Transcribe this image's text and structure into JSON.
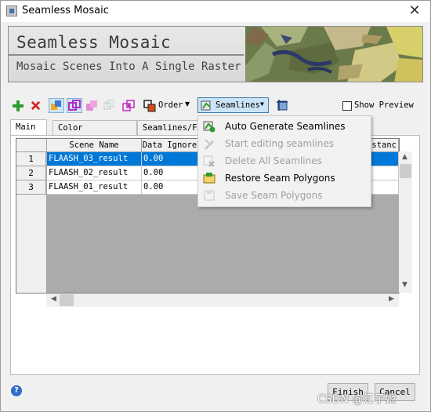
{
  "window": {
    "title": "Seamless Mosaic",
    "close_glyph": "✕"
  },
  "banner": {
    "title": "Seamless Mosaic",
    "subtitle": "Mosaic Scenes Into A Single Raster"
  },
  "toolbar": {
    "order_label": "Order",
    "seamlines_label": "Seamlines",
    "show_preview_label": "Show Preview",
    "show_preview_checked": false
  },
  "tabs": [
    {
      "label": "Main",
      "active": true
    },
    {
      "label": "Color Correction",
      "active": false
    },
    {
      "label": "Seamlines/Fe",
      "active": false
    }
  ],
  "table": {
    "columns": [
      "Scene Name",
      "Data Ignore",
      "istanc"
    ],
    "rows": [
      {
        "index": "1",
        "scene": "FLAASH_03_result",
        "ignore": "0.00",
        "selected": true
      },
      {
        "index": "2",
        "scene": "FLAASH_02_result",
        "ignore": "0.00",
        "selected": false
      },
      {
        "index": "3",
        "scene": "FLAASH_01_result",
        "ignore": "0.00",
        "selected": false
      }
    ]
  },
  "seamlines_menu": [
    {
      "label": "Auto Generate Seamlines",
      "enabled": true,
      "icon": "auto-generate-icon"
    },
    {
      "label": "Start editing seamlines",
      "enabled": false,
      "icon": "edit-seamlines-icon"
    },
    {
      "label": "Delete All Seamlines",
      "enabled": false,
      "icon": "delete-seamlines-icon"
    },
    {
      "label": "Restore Seam Polygons",
      "enabled": true,
      "icon": "restore-polygons-icon"
    },
    {
      "label": "Save Seam Polygons",
      "enabled": false,
      "icon": "save-polygons-icon"
    }
  ],
  "buttons": {
    "finish": "Finish",
    "cancel": "Cancel",
    "help": "?"
  },
  "watermark": "CSDN @江子姬",
  "colors": {
    "selection": "#0078d7",
    "accent_green": "#2e9b2e",
    "delete_red": "#d42020",
    "highlight": "#cce4f7"
  }
}
